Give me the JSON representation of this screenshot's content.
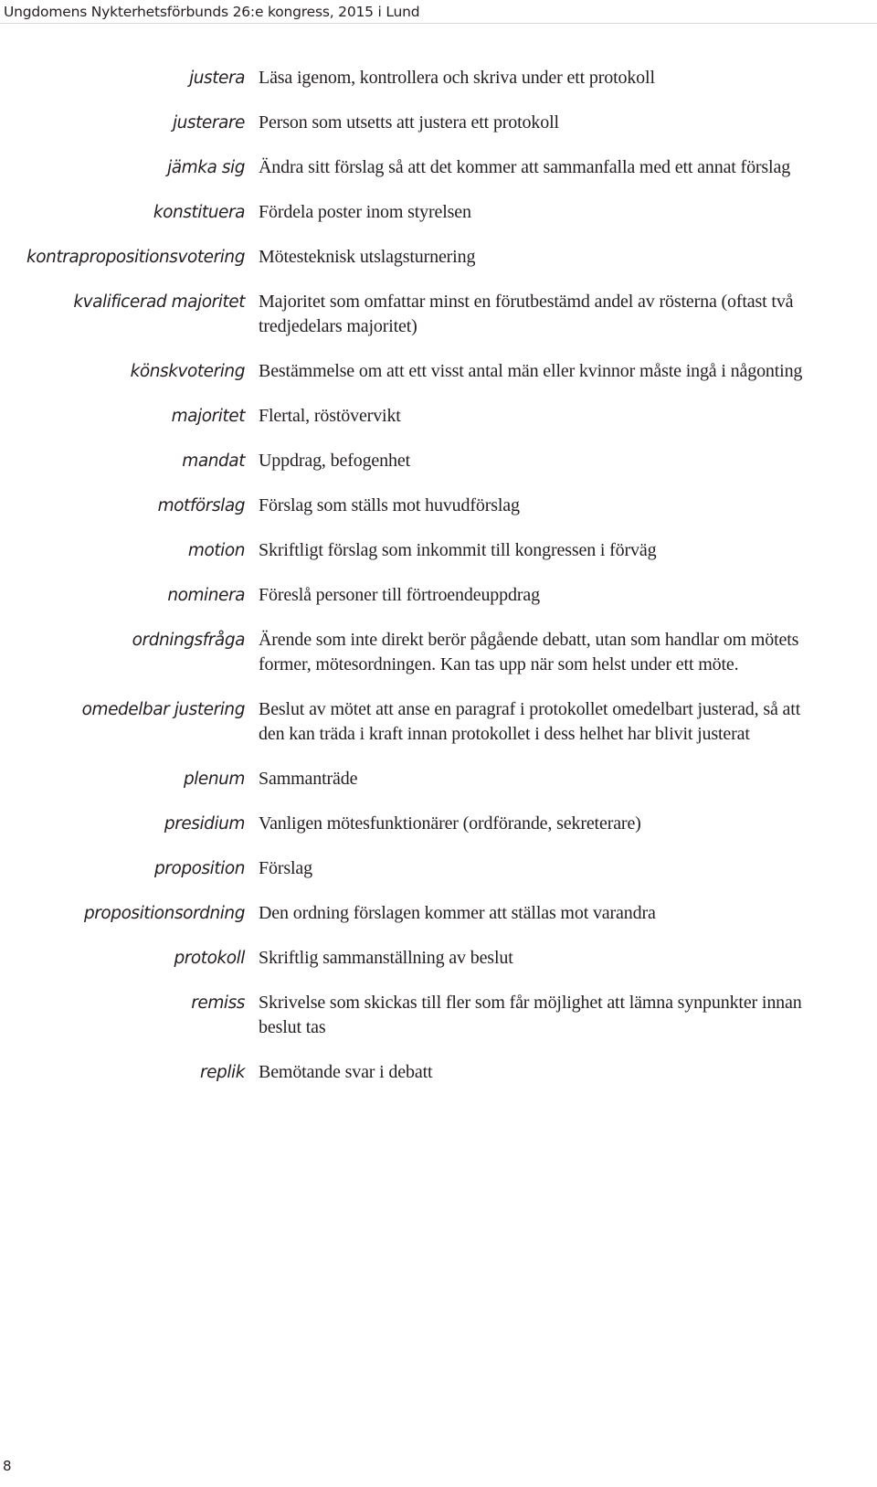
{
  "header": {
    "running_title": "Ungdomens Nykterhetsförbunds 26:e kongress, 2015 i Lund"
  },
  "footer": {
    "page_number": "8"
  },
  "glossary": {
    "entries": [
      {
        "term": "justera",
        "definition": "Läsa igenom, kontrollera och skriva under ett protokoll"
      },
      {
        "term": "justerare",
        "definition": "Person som utsetts att justera ett protokoll"
      },
      {
        "term": "jämka sig",
        "definition": "Ändra sitt förslag så att det kommer att sammanfalla med ett annat förslag"
      },
      {
        "term": "konstituera",
        "definition": "Fördela poster inom styrelsen"
      },
      {
        "term": "kontrapropositionsvotering",
        "definition": "Mötesteknisk utslagsturnering"
      },
      {
        "term": "kvalificerad majoritet",
        "definition": "Majoritet som omfattar minst en förutbestämd andel av rösterna (oftast två tredjedelars majoritet)"
      },
      {
        "term": "könskvotering",
        "definition": "Bestämmelse om att ett visst antal män eller kvinnor måste ingå i någonting"
      },
      {
        "term": "majoritet",
        "definition": "Flertal, röstövervikt"
      },
      {
        "term": "mandat",
        "definition": "Uppdrag, befogenhet"
      },
      {
        "term": "motförslag",
        "definition": "Förslag som ställs mot huvudförslag"
      },
      {
        "term": "motion",
        "definition": "Skriftligt förslag som inkommit till kongressen i förväg"
      },
      {
        "term": "nominera",
        "definition": "Föreslå personer till förtroendeuppdrag"
      },
      {
        "term": "ordningsfråga",
        "definition": "Ärende som inte direkt berör pågående debatt, utan som handlar om mötets former, mötesordningen. Kan tas upp när som helst under ett möte."
      },
      {
        "term": "omedelbar justering",
        "definition": "Beslut av mötet att anse en paragraf i protokollet omedelbart justerad, så att den kan träda i kraft innan protokollet i dess helhet har blivit justerat"
      },
      {
        "term": "plenum",
        "definition": "Sammanträde"
      },
      {
        "term": "presidium",
        "definition": "Vanligen mötesfunktionärer (ordförande, sekreterare)"
      },
      {
        "term": "proposition",
        "definition": "Förslag"
      },
      {
        "term": "propositionsordning",
        "definition": "Den ordning förslagen kommer att ställas mot varandra"
      },
      {
        "term": "protokoll",
        "definition": "Skriftlig sammanställning av beslut"
      },
      {
        "term": "remiss",
        "definition": "Skrivelse som skickas till fler som får möjlighet att lämna synpunkter innan beslut tas"
      },
      {
        "term": "replik",
        "definition": "Bemötande svar i debatt"
      }
    ]
  }
}
